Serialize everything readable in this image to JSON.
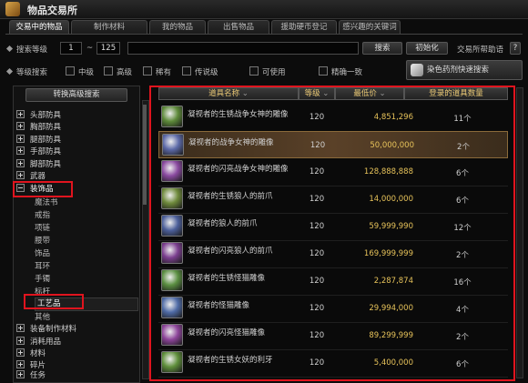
{
  "window": {
    "title": "物品交易所"
  },
  "tabs": [
    {
      "label": "交易中的物品",
      "active": true
    },
    {
      "label": "制作材料",
      "active": false
    },
    {
      "label": "我的物品",
      "active": false
    },
    {
      "label": "出售物品",
      "active": false
    },
    {
      "label": "援助硬币登记",
      "active": false
    },
    {
      "label": "感兴趣的关键词",
      "active": false
    }
  ],
  "search": {
    "level_label": "搜索等级",
    "level_min": "1",
    "level_sep": "~",
    "level_max": "125",
    "keyword_value": "",
    "search_button": "搜索",
    "reset_button": "初始化",
    "help_label": "交易所帮助语"
  },
  "filters": {
    "grade_label": "等级搜索",
    "options": [
      "中级",
      "高级",
      "稀有",
      "传说级",
      "可使用",
      "精确一致"
    ]
  },
  "dye_button": "染色药剂快速搜索",
  "advanced_button": "转换高级搜索",
  "categories": [
    {
      "label": "头部防具",
      "expanded": false
    },
    {
      "label": "胸部防具",
      "expanded": false
    },
    {
      "label": "腿部防具",
      "expanded": false
    },
    {
      "label": "手部防具",
      "expanded": false
    },
    {
      "label": "脚部防具",
      "expanded": false
    },
    {
      "label": "武器",
      "expanded": false
    },
    {
      "label": "装饰品",
      "expanded": true
    },
    {
      "label": "装备制作材料",
      "expanded": false
    },
    {
      "label": "消耗用品",
      "expanded": false
    },
    {
      "label": "材料",
      "expanded": false
    },
    {
      "label": "碎片",
      "expanded": false
    },
    {
      "label": "任务",
      "expanded": false
    }
  ],
  "subcategories": [
    "魔法书",
    "戒指",
    "项链",
    "腰带",
    "饰品",
    "耳环",
    "手镯",
    "标杆",
    "工艺品",
    "其他"
  ],
  "selected_subcategory": "工艺品",
  "table": {
    "headers": [
      "道具名称",
      "等级",
      "最低价",
      "登录的道具数量"
    ],
    "rows": [
      {
        "name": "凝视者的生锈战争女神的雕像",
        "level": "120",
        "price": "4,851,296",
        "qty": "11个",
        "icon_color": "#5e8a3a",
        "selected": false
      },
      {
        "name": "凝视者的战争女神的雕像",
        "level": "120",
        "price": "50,000,000",
        "qty": "2个",
        "icon_color": "#5d6aa8",
        "selected": true
      },
      {
        "name": "凝视者的闪亮战争女神的雕像",
        "level": "120",
        "price": "128,888,888",
        "qty": "6个",
        "icon_color": "#8a4aa0",
        "selected": false
      },
      {
        "name": "凝视者的生锈狼人的前爪",
        "level": "120",
        "price": "14,000,000",
        "qty": "6个",
        "icon_color": "#6f8a3c",
        "selected": false
      },
      {
        "name": "凝视者的狼人的前爪",
        "level": "120",
        "price": "59,999,990",
        "qty": "12个",
        "icon_color": "#4c5f9a",
        "selected": false
      },
      {
        "name": "凝视者的闪亮狼人的前爪",
        "level": "120",
        "price": "169,999,999",
        "qty": "2个",
        "icon_color": "#7b3f8f",
        "selected": false
      },
      {
        "name": "凝视者的生锈怪猫雕像",
        "level": "120",
        "price": "2,287,874",
        "qty": "16个",
        "icon_color": "#5b8f42",
        "selected": false
      },
      {
        "name": "凝视者的怪猫雕像",
        "level": "120",
        "price": "29,994,000",
        "qty": "4个",
        "icon_color": "#4f6ba6",
        "selected": false
      },
      {
        "name": "凝视者的闪亮怪猫雕像",
        "level": "120",
        "price": "89,299,999",
        "qty": "2个",
        "icon_color": "#8d459a",
        "selected": false
      },
      {
        "name": "凝视者的生锈女妖的利牙",
        "level": "120",
        "price": "5,400,000",
        "qty": "6个",
        "icon_color": "#5f8f3b",
        "selected": false
      }
    ]
  },
  "colors": {
    "accent_gold": "#e6c25a",
    "highlight_red": "#e0141e"
  }
}
